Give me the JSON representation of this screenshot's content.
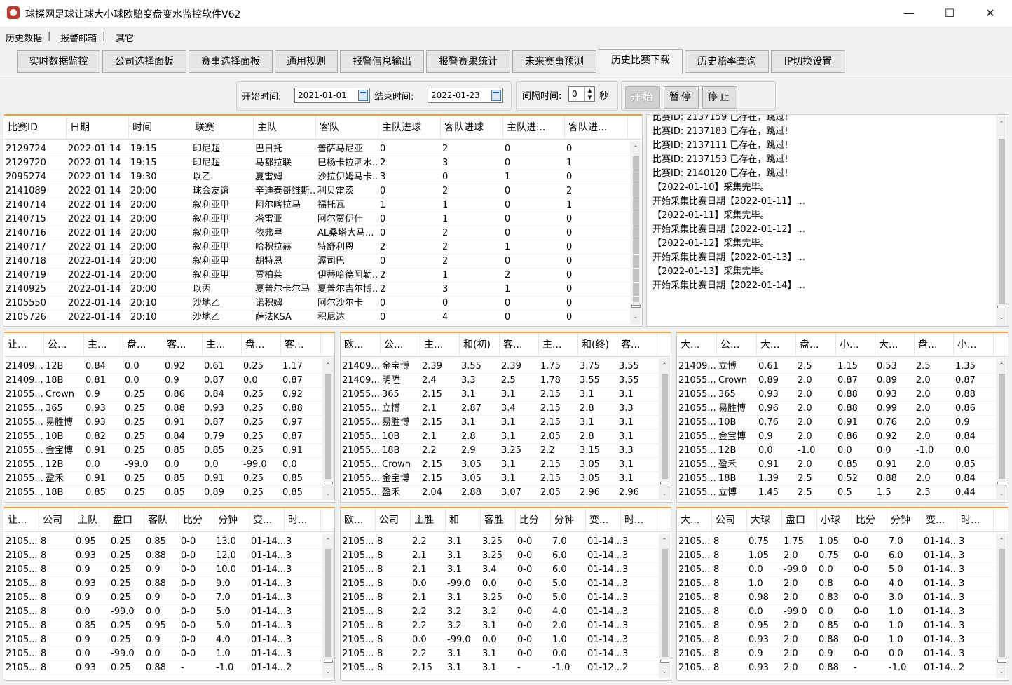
{
  "window": {
    "title": "球探网足球让球大小球欧赔变盘变水监控软件V62",
    "controls": [
      "—",
      "☐",
      "✕"
    ]
  },
  "menu": [
    "历史数据",
    "报警邮箱",
    "其它"
  ],
  "tabs": [
    "实时数据监控",
    "公司选择面板",
    "赛事选择面板",
    "通用规则",
    "报警信息输出",
    "报警赛果统计",
    "未来赛事预测",
    "历史比赛下载",
    "历史赔率查询",
    "IP切换设置"
  ],
  "active_tab": "历史比赛下载",
  "controls": {
    "start_label": "开始时间:",
    "start_value": "2021-01-01",
    "end_label": "结束时间:",
    "end_value": "2022-01-23",
    "interval_label": "间隔时间:",
    "interval_value": "0",
    "interval_unit": "秒",
    "start_btn": "开始",
    "pause_btn": "暂停",
    "stop_btn": "停止"
  },
  "matches": {
    "headers": [
      "比赛ID",
      "日期",
      "时间",
      "联赛",
      "主队",
      "客队",
      "主队进球",
      "客队进球",
      "主队进...",
      "客队进..."
    ],
    "rows": [
      [
        "2129724",
        "2022-01-14",
        "19:15",
        "印尼超",
        "巴日托",
        "普萨马尼亚",
        "0",
        "2",
        "0",
        "0"
      ],
      [
        "2129720",
        "2022-01-14",
        "19:15",
        "印尼超",
        "马都拉联",
        "巴杨卡拉泗水...",
        "2",
        "3",
        "0",
        "1"
      ],
      [
        "2095274",
        "2022-01-14",
        "19:30",
        "以乙",
        "夏雷姆",
        "沙拉伊姆马卡...",
        "3",
        "0",
        "1",
        "0"
      ],
      [
        "2141089",
        "2022-01-14",
        "20:00",
        "球会友谊",
        "辛迪泰哥维斯...",
        "利贝雷茨",
        "0",
        "2",
        "0",
        "2"
      ],
      [
        "2140714",
        "2022-01-14",
        "20:00",
        "叙利亚甲",
        "阿尔喀拉马",
        "福托瓦",
        "1",
        "1",
        "0",
        "1"
      ],
      [
        "2140715",
        "2022-01-14",
        "20:00",
        "叙利亚甲",
        "塔雷亚",
        "阿尔贾伊什",
        "0",
        "1",
        "0",
        "0"
      ],
      [
        "2140716",
        "2022-01-14",
        "20:00",
        "叙利亚甲",
        "依弗里",
        "AL桑塔大马...",
        "0",
        "2",
        "0",
        "0"
      ],
      [
        "2140717",
        "2022-01-14",
        "20:00",
        "叙利亚甲",
        "哈积拉赫",
        "特舒利恩",
        "2",
        "2",
        "1",
        "0"
      ],
      [
        "2140718",
        "2022-01-14",
        "20:00",
        "叙利亚甲",
        "胡特恩",
        "渥司巴",
        "0",
        "2",
        "0",
        "0"
      ],
      [
        "2140719",
        "2022-01-14",
        "20:00",
        "叙利亚甲",
        "贾柏莱",
        "伊蒂哈德阿勒...",
        "2",
        "1",
        "2",
        "0"
      ],
      [
        "2140925",
        "2022-01-14",
        "20:00",
        "以丙",
        "夏普尔卡尔马",
        "夏普尔吉尔博...",
        "2",
        "3",
        "1",
        "0"
      ],
      [
        "2105550",
        "2022-01-14",
        "20:10",
        "沙地乙",
        "诺积姆",
        "阿尔沙尔卡",
        "0",
        "0",
        "0",
        "0"
      ],
      [
        "2105726",
        "2022-01-14",
        "20:10",
        "沙地乙",
        "萨法KSA",
        "积尼达",
        "0",
        "4",
        "0",
        "0"
      ]
    ]
  },
  "log": [
    "比赛ID: 2137159 已存在，跳过!",
    "比赛ID: 2137183 已存在，跳过!",
    "比赛ID: 2137111 已存在，跳过!",
    "比赛ID: 2137153 已存在，跳过!",
    "比赛ID: 2140120 已存在，跳过!",
    "【2022-01-10】采集完毕。",
    "开始采集比赛日期【2022-01-11】...",
    "【2022-01-11】采集完毕。",
    "开始采集比赛日期【2022-01-12】...",
    "【2022-01-12】采集完毕。",
    "开始采集比赛日期【2022-01-13】...",
    "【2022-01-13】采集完毕。",
    "开始采集比赛日期【2022-01-14】..."
  ],
  "asian_odds": {
    "headers": [
      "让...",
      "公...",
      "主...",
      "盘...",
      "客...",
      "主...",
      "盘...",
      "客..."
    ],
    "rows": [
      [
        "21409...",
        "12B",
        "0.84",
        "0.0",
        "0.92",
        "0.61",
        "0.25",
        "1.17"
      ],
      [
        "21409...",
        "18B",
        "0.81",
        "0.0",
        "0.9",
        "0.87",
        "0.0",
        "0.87"
      ],
      [
        "21055...",
        "Crown",
        "0.9",
        "0.25",
        "0.86",
        "0.84",
        "0.25",
        "0.92"
      ],
      [
        "21055...",
        "365",
        "0.93",
        "0.25",
        "0.88",
        "0.93",
        "0.25",
        "0.88"
      ],
      [
        "21055...",
        "易胜博",
        "0.93",
        "0.25",
        "0.91",
        "0.87",
        "0.25",
        "0.97"
      ],
      [
        "21055...",
        "10B",
        "0.82",
        "0.25",
        "0.84",
        "0.79",
        "0.25",
        "0.87"
      ],
      [
        "21055...",
        "金宝博",
        "0.91",
        "0.25",
        "0.85",
        "0.85",
        "0.25",
        "0.91"
      ],
      [
        "21055...",
        "12B",
        "0.0",
        "-99.0",
        "0.0",
        "0.0",
        "-99.0",
        "0.0"
      ],
      [
        "21055...",
        "盈禾",
        "0.91",
        "0.25",
        "0.85",
        "0.91",
        "0.25",
        "0.85"
      ],
      [
        "21055...",
        "18B",
        "0.85",
        "0.25",
        "0.85",
        "0.89",
        "0.25",
        "0.85"
      ]
    ]
  },
  "euro_odds": {
    "headers": [
      "欧...",
      "公...",
      "主...",
      "和(初)",
      "客...",
      "主...",
      "和(终)",
      "客..."
    ],
    "rows": [
      [
        "21409...",
        "金宝博",
        "2.39",
        "3.55",
        "2.39",
        "1.75",
        "3.75",
        "3.55"
      ],
      [
        "21409...",
        "明陞",
        "2.4",
        "3.3",
        "2.5",
        "1.78",
        "3.55",
        "3.55"
      ],
      [
        "21055...",
        "365",
        "2.15",
        "3.1",
        "3.1",
        "2.15",
        "3.1",
        "3.1"
      ],
      [
        "21055...",
        "立博",
        "2.1",
        "2.87",
        "3.4",
        "2.15",
        "2.8",
        "3.3"
      ],
      [
        "21055...",
        "易胜博",
        "2.15",
        "3.1",
        "3.1",
        "2.15",
        "3.1",
        "3.1"
      ],
      [
        "21055...",
        "10B",
        "2.1",
        "2.8",
        "3.1",
        "2.05",
        "2.8",
        "3.1"
      ],
      [
        "21055...",
        "18B",
        "2.2",
        "2.9",
        "3.25",
        "2.2",
        "3.15",
        "3.3"
      ],
      [
        "21055...",
        "Crown",
        "2.15",
        "3.05",
        "3.1",
        "2.15",
        "3.05",
        "3.1"
      ],
      [
        "21055...",
        "金宝博",
        "2.15",
        "3.05",
        "3.1",
        "2.15",
        "3.05",
        "3.1"
      ],
      [
        "21055...",
        "盈禾",
        "2.04",
        "2.88",
        "3.07",
        "2.05",
        "2.96",
        "2.96"
      ]
    ]
  },
  "ou_odds": {
    "headers": [
      "大...",
      "公...",
      "大...",
      "盘...",
      "小...",
      "大...",
      "盘...",
      "小..."
    ],
    "rows": [
      [
        "21409...",
        "立博",
        "0.61",
        "2.5",
        "1.15",
        "0.53",
        "2.5",
        "1.35"
      ],
      [
        "21055...",
        "Crown",
        "0.89",
        "2.0",
        "0.87",
        "0.89",
        "2.0",
        "0.87"
      ],
      [
        "21055...",
        "365",
        "0.93",
        "2.0",
        "0.88",
        "0.93",
        "2.0",
        "0.88"
      ],
      [
        "21055...",
        "易胜博",
        "0.96",
        "2.0",
        "0.88",
        "0.99",
        "2.0",
        "0.86"
      ],
      [
        "21055...",
        "10B",
        "0.76",
        "2.0",
        "0.91",
        "0.76",
        "2.0",
        "0.9"
      ],
      [
        "21055...",
        "金宝博",
        "0.9",
        "2.0",
        "0.86",
        "0.92",
        "2.0",
        "0.84"
      ],
      [
        "21055...",
        "12B",
        "0.0",
        "-1.0",
        "0.0",
        "0.0",
        "-1.0",
        "0.0"
      ],
      [
        "21055...",
        "盈禾",
        "0.91",
        "2.0",
        "0.85",
        "0.91",
        "2.0",
        "0.85"
      ],
      [
        "21055...",
        "18B",
        "1.39",
        "2.5",
        "0.52",
        "0.88",
        "2.0",
        "0.84"
      ],
      [
        "21055...",
        "立博",
        "1.45",
        "2.5",
        "0.5",
        "1.5",
        "2.5",
        "0.44"
      ]
    ]
  },
  "asian_changes": {
    "headers": [
      "让...",
      "公司",
      "主队",
      "盘口",
      "客队",
      "比分",
      "分钟",
      "变...",
      "时..."
    ],
    "rows": [
      [
        "2105...",
        "8",
        "0.95",
        "0.25",
        "0.85",
        "0-0",
        "13.0",
        "01-14...",
        "3"
      ],
      [
        "2105...",
        "8",
        "0.93",
        "0.25",
        "0.88",
        "0-0",
        "12.0",
        "01-14...",
        "3"
      ],
      [
        "2105...",
        "8",
        "0.9",
        "0.25",
        "0.9",
        "0-0",
        "10.0",
        "01-14...",
        "3"
      ],
      [
        "2105...",
        "8",
        "0.93",
        "0.25",
        "0.88",
        "0-0",
        "9.0",
        "01-14...",
        "3"
      ],
      [
        "2105...",
        "8",
        "0.9",
        "0.25",
        "0.9",
        "0-0",
        "7.0",
        "01-14...",
        "3"
      ],
      [
        "2105...",
        "8",
        "0.0",
        "-99.0",
        "0.0",
        "0-0",
        "5.0",
        "01-14...",
        "3"
      ],
      [
        "2105...",
        "8",
        "0.85",
        "0.25",
        "0.95",
        "0-0",
        "5.0",
        "01-14...",
        "3"
      ],
      [
        "2105...",
        "8",
        "0.9",
        "0.25",
        "0.9",
        "0-0",
        "4.0",
        "01-14...",
        "3"
      ],
      [
        "2105...",
        "8",
        "0.0",
        "-99.0",
        "0.0",
        "0-0",
        "1.0",
        "01-14...",
        "3"
      ],
      [
        "2105...",
        "8",
        "0.93",
        "0.25",
        "0.88",
        "-",
        "-1.0",
        "01-14...",
        "2"
      ]
    ]
  },
  "euro_changes": {
    "headers": [
      "欧...",
      "公司",
      "主胜",
      "和",
      "客胜",
      "比分",
      "分钟",
      "变...",
      "时..."
    ],
    "rows": [
      [
        "2105...",
        "8",
        "2.2",
        "3.1",
        "3.25",
        "0-0",
        "7.0",
        "01-14...",
        "3"
      ],
      [
        "2105...",
        "8",
        "2.1",
        "3.1",
        "3.25",
        "0-0",
        "6.0",
        "01-14...",
        "3"
      ],
      [
        "2105...",
        "8",
        "2.1",
        "3.1",
        "3.4",
        "0-0",
        "6.0",
        "01-14...",
        "3"
      ],
      [
        "2105...",
        "8",
        "0.0",
        "-99.0",
        "0.0",
        "0-0",
        "5.0",
        "01-14...",
        "3"
      ],
      [
        "2105...",
        "8",
        "2.1",
        "3.1",
        "3.25",
        "0-0",
        "5.0",
        "01-14...",
        "3"
      ],
      [
        "2105...",
        "8",
        "2.2",
        "3.2",
        "3.2",
        "0-0",
        "4.0",
        "01-14...",
        "3"
      ],
      [
        "2105...",
        "8",
        "2.2",
        "3.2",
        "3.1",
        "0-0",
        "2.0",
        "01-14...",
        "3"
      ],
      [
        "2105...",
        "8",
        "0.0",
        "-99.0",
        "0.0",
        "0-0",
        "1.0",
        "01-14...",
        "3"
      ],
      [
        "2105...",
        "8",
        "2.2",
        "3.1",
        "3.1",
        "0-0",
        "0.0",
        "01-14...",
        "3"
      ],
      [
        "2105...",
        "8",
        "2.15",
        "3.1",
        "3.1",
        "-",
        "-1.0",
        "01-12...",
        "2"
      ]
    ]
  },
  "ou_changes": {
    "headers": [
      "大...",
      "公司",
      "大球",
      "盘口",
      "小球",
      "比分",
      "分钟",
      "变...",
      "时..."
    ],
    "rows": [
      [
        "2105...",
        "8",
        "0.75",
        "1.75",
        "1.05",
        "0-0",
        "7.0",
        "01-14...",
        "3"
      ],
      [
        "2105...",
        "8",
        "1.05",
        "2.0",
        "0.75",
        "0-0",
        "6.0",
        "01-14...",
        "3"
      ],
      [
        "2105...",
        "8",
        "0.0",
        "-99.0",
        "0.0",
        "0-0",
        "5.0",
        "01-14...",
        "3"
      ],
      [
        "2105...",
        "8",
        "1.0",
        "2.0",
        "0.8",
        "0-0",
        "4.0",
        "01-14...",
        "3"
      ],
      [
        "2105...",
        "8",
        "0.98",
        "2.0",
        "0.83",
        "0-0",
        "3.0",
        "01-14...",
        "3"
      ],
      [
        "2105...",
        "8",
        "0.0",
        "-99.0",
        "0.0",
        "0-0",
        "1.0",
        "01-14...",
        "3"
      ],
      [
        "2105...",
        "8",
        "0.95",
        "2.0",
        "0.85",
        "0-0",
        "1.0",
        "01-14...",
        "3"
      ],
      [
        "2105...",
        "8",
        "0.93",
        "2.0",
        "0.88",
        "0-0",
        "1.0",
        "01-14...",
        "3"
      ],
      [
        "2105...",
        "8",
        "0.9",
        "2.0",
        "0.9",
        "0-0",
        "0.0",
        "01-14...",
        "3"
      ],
      [
        "2105...",
        "8",
        "0.93",
        "2.0",
        "0.88",
        "-",
        "-1.0",
        "01-14...",
        "2"
      ]
    ]
  }
}
